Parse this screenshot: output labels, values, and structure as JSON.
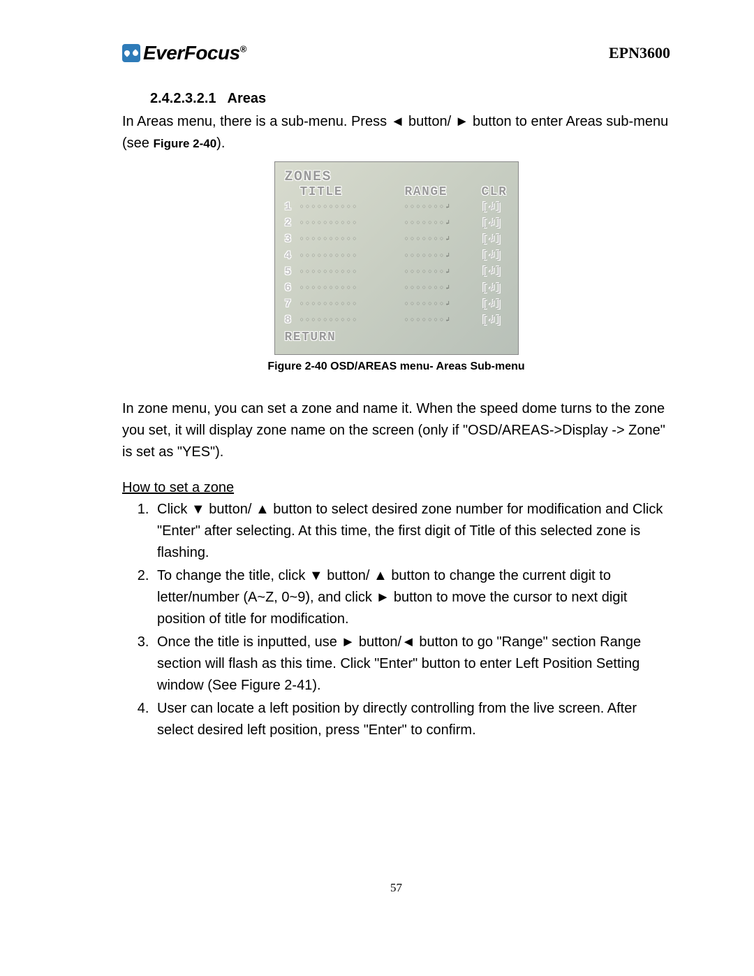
{
  "header": {
    "brand": "EverFocus",
    "model": "EPN3600"
  },
  "section": {
    "number": "2.4.2.3.2.1",
    "title": "Areas"
  },
  "intro": "In Areas menu, there is a sub-menu. Press ◄ button/ ► button to enter Areas sub-menu (see ",
  "intro_figref": "Figure 2-40",
  "intro_tail": ").",
  "osd": {
    "header": "ZONES",
    "col_title": "TITLE",
    "col_range": "RANGE",
    "col_clr": "CLR",
    "rows": [
      "1",
      "2",
      "3",
      "4",
      "5",
      "6",
      "7",
      "8"
    ],
    "dots1": "○○○○○○○○○○",
    "dots2": "○○○○○○○↲",
    "clrcell": "[↲]",
    "return": "RETURN"
  },
  "fig_caption": "Figure 2-40 OSD/AREAS menu- Areas Sub-menu",
  "para2": "In zone menu, you can set a zone and name it. When the speed dome turns to the zone you set, it will display zone name on the screen (only if \"OSD/AREAS->Display -> Zone\" is set as \"YES\").",
  "howto_title": "How to set a zone",
  "steps": [
    "Click ▼ button/ ▲ button to select desired zone number for modification and Click \"Enter\" after selecting.   At this time, the first digit of Title of this selected zone is flashing.",
    "To change the title, click ▼ button/ ▲ button to change the current digit to letter/number (A~Z, 0~9), and click ► button to move the cursor to next digit position of title for modification.",
    "Once the title is inputted, use ► button/◄ button to go \"Range\" section Range section will flash as this time. Click \"Enter\" button to enter Left Position Setting window (See Figure 2-41).",
    "User can locate a left position by directly controlling from the live screen. After select desired left position, press \"Enter\" to confirm."
  ],
  "page_number": "57"
}
